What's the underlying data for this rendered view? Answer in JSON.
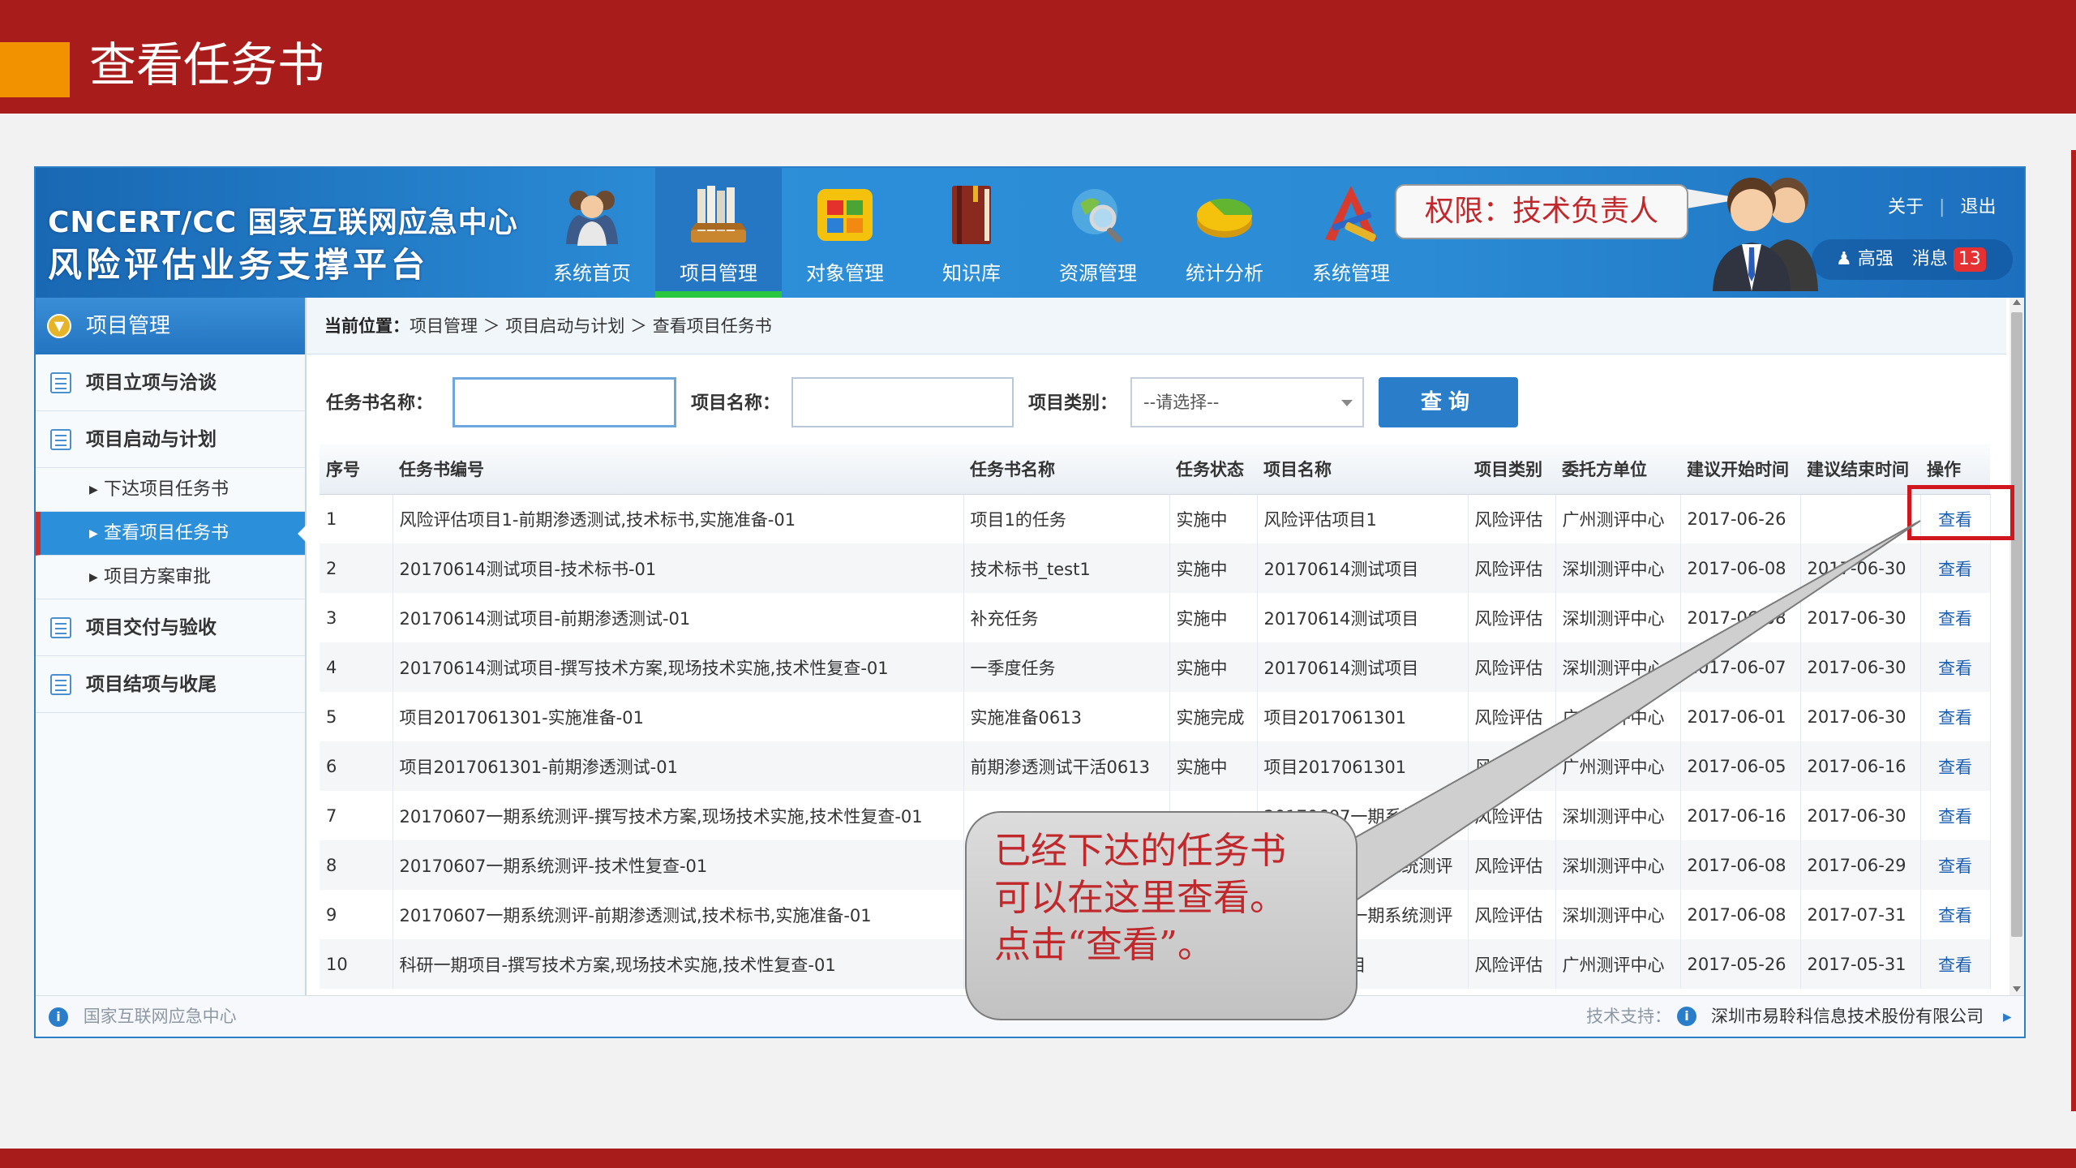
{
  "slide": {
    "title": "查看任务书"
  },
  "app": {
    "logo": {
      "line1": "CNCERT/CC 国家互联网应急中心",
      "line2": "风险评估业务支撑平台"
    },
    "nav": [
      {
        "label": "系统首页",
        "icon": "users-icon"
      },
      {
        "label": "项目管理",
        "icon": "books-icon"
      },
      {
        "label": "对象管理",
        "icon": "windows-icon"
      },
      {
        "label": "知识库",
        "icon": "book-icon"
      },
      {
        "label": "资源管理",
        "icon": "globe-search-icon"
      },
      {
        "label": "统计分析",
        "icon": "pie-chart-icon"
      },
      {
        "label": "系统管理",
        "icon": "tools-icon"
      }
    ],
    "permission": "权限：技术负责人",
    "top_links": {
      "about": "关于",
      "logout": "退出",
      "separator": "|"
    },
    "user": {
      "name": "高强",
      "messages_label": "消息",
      "message_count": "13"
    },
    "sidebar": {
      "header": "项目管理",
      "items": [
        {
          "label": "项目立项与洽谈"
        },
        {
          "label": "项目启动与计划"
        },
        {
          "label": "下达项目任务书"
        },
        {
          "label": "查看项目任务书"
        },
        {
          "label": "项目方案审批"
        },
        {
          "label": "项目交付与验收"
        },
        {
          "label": "项目结项与收尾"
        }
      ]
    },
    "breadcrumb": {
      "label": "当前位置：",
      "path": "项目管理 ＞ 项目启动与计划 ＞ 查看项目任务书"
    },
    "search": {
      "task_name_label": "任务书名称：",
      "task_name_value": "",
      "project_name_label": "项目名称：",
      "project_name_value": "",
      "project_type_label": "项目类别：",
      "project_type_value": "--请选择--",
      "query_button": "查询"
    },
    "table": {
      "headers": [
        "序号",
        "任务书编号",
        "任务书名称",
        "任务状态",
        "项目名称",
        "项目类别",
        "委托方单位",
        "建议开始时间",
        "建议结束时间",
        "操作"
      ],
      "rows": [
        [
          "1",
          "风险评估项目1-前期渗透测试,技术标书,实施准备-01",
          "项目1的任务",
          "实施中",
          "风险评估项目1",
          "风险评估",
          "广州测评中心",
          "2017-06-26",
          "",
          "查看"
        ],
        [
          "2",
          "20170614测试项目-技术标书-01",
          "技术标书_test1",
          "实施中",
          "20170614测试项目",
          "风险评估",
          "深圳测评中心",
          "2017-06-08",
          "2017-06-30",
          "查看"
        ],
        [
          "3",
          "20170614测试项目-前期渗透测试-01",
          "补充任务",
          "实施中",
          "20170614测试项目",
          "风险评估",
          "深圳测评中心",
          "2017-06-08",
          "2017-06-30",
          "查看"
        ],
        [
          "4",
          "20170614测试项目-撰写技术方案,现场技术实施,技术性复查-01",
          "一季度任务",
          "实施中",
          "20170614测试项目",
          "风险评估",
          "深圳测评中心",
          "2017-06-07",
          "2017-06-30",
          "查看"
        ],
        [
          "5",
          "项目2017061301-实施准备-01",
          "实施准备0613",
          "实施完成",
          "项目2017061301",
          "风险评估",
          "广州测评中心",
          "2017-06-01",
          "2017-06-30",
          "查看"
        ],
        [
          "6",
          "项目2017061301-前期渗透测试-01",
          "前期渗透测试干活0613",
          "实施中",
          "项目2017061301",
          "风险评估",
          "广州测评中心",
          "2017-06-05",
          "2017-06-16",
          "查看"
        ],
        [
          "7",
          "20170607一期系统测评-撰写技术方案,现场技术实施,技术性复查-01",
          "",
          "",
          "20170607一期系统测评",
          "风险评估",
          "深圳测评中心",
          "2017-06-16",
          "2017-06-30",
          "查看"
        ],
        [
          "8",
          "20170607一期系统测评-技术性复查-01",
          "",
          "",
          "20170607一期系统测评",
          "风险评估",
          "深圳测评中心",
          "2017-06-08",
          "2017-06-29",
          "查看"
        ],
        [
          "9",
          "20170607一期系统测评-前期渗透测试,技术标书,实施准备-01",
          "",
          "",
          "20170607一期系统测评",
          "风险评估",
          "深圳测评中心",
          "2017-06-08",
          "2017-07-31",
          "查看"
        ],
        [
          "10",
          "科研一期项目-撰写技术方案,现场技术实施,技术性复查-01",
          "",
          "",
          "科研一期项目",
          "风险评估",
          "广州测评中心",
          "2017-05-26",
          "2017-05-31",
          "查看"
        ]
      ]
    },
    "status": {
      "left": "国家互联网应急中心",
      "support_label": "技术支持：",
      "support_company": "深圳市易聆科信息技术股份有限公司"
    }
  },
  "callout": {
    "line1": "已经下达的任务书",
    "line2": "可以在这里查看。",
    "line3": "点击“查看”。"
  },
  "colors": {
    "slide_red": "#a81c1b",
    "accent_orange": "#f39200",
    "banner_blue": "#2b8bd4",
    "highlight_red": "#d0171d",
    "callout_text": "#c0282b"
  }
}
